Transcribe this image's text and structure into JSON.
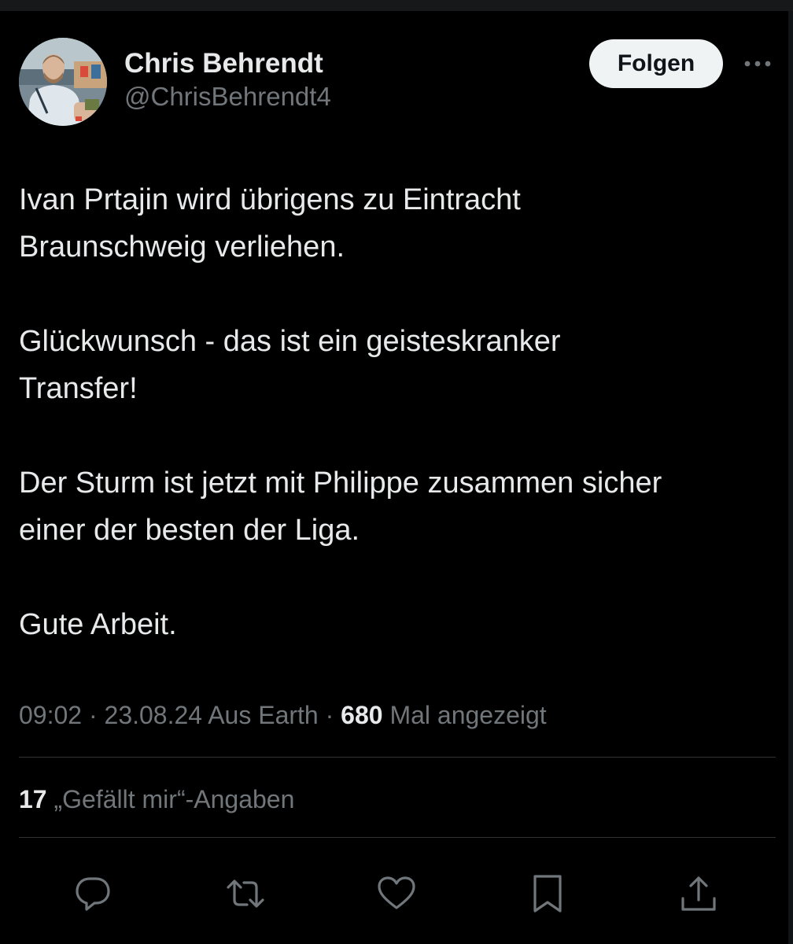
{
  "author": {
    "display_name": "Chris Behrendt",
    "handle": "@ChrisBehrendt4",
    "avatar_alt": "profile photo"
  },
  "header": {
    "follow_label": "Folgen",
    "more_icon": "more-horizontal-icon"
  },
  "tweet": {
    "paragraphs": [
      "Ivan Prtajin wird übrigens zu Eintracht\nBraunschweig verliehen.",
      "Glückwunsch - das ist ein geisteskranker\nTransfer!",
      "Der Sturm ist jetzt mit Philippe zusammen sicher\neiner der besten der Liga.",
      "Gute Arbeit."
    ]
  },
  "meta": {
    "time": "09:02",
    "date": "23.08.24",
    "source": "Aus Earth",
    "separator": "·",
    "views_count": "680",
    "views_label": "Mal angezeigt"
  },
  "engagement": {
    "likes_count": "17",
    "likes_label": "„Gefällt mir“-Angaben"
  },
  "actions": [
    {
      "name": "reply-icon"
    },
    {
      "name": "retweet-icon"
    },
    {
      "name": "like-icon"
    },
    {
      "name": "bookmark-icon"
    },
    {
      "name": "share-icon"
    }
  ],
  "colors": {
    "background": "#000000",
    "text_primary": "#e7e9ea",
    "text_secondary": "#71767b",
    "divider": "#2f3336",
    "follow_button_bg": "#eff3f4",
    "follow_button_text": "#0f1419"
  }
}
